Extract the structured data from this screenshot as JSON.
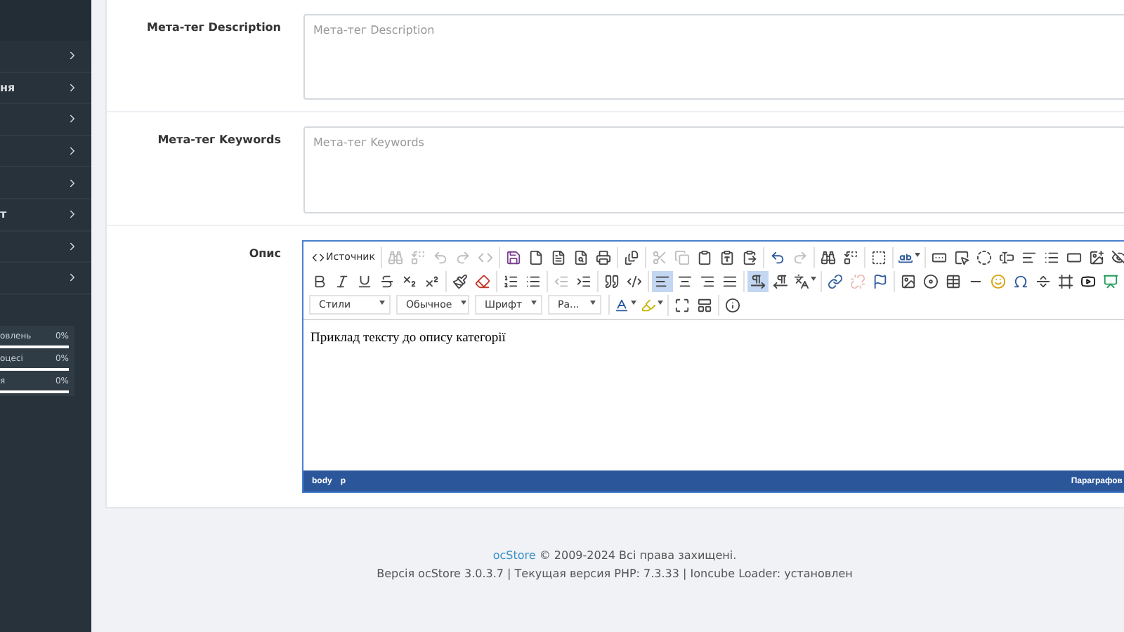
{
  "sidebar": {
    "menu_items": [
      {
        "expanded": false
      },
      {
        "label": "ня",
        "expanded": false
      },
      {
        "expanded": false
      },
      {
        "expanded": false
      },
      {
        "expanded": false
      },
      {
        "label": "т",
        "expanded": false
      },
      {
        "expanded": false
      },
      {
        "expanded": false
      }
    ],
    "stats": [
      {
        "label": "овлень",
        "value": "0%",
        "level": 0
      },
      {
        "label": "оцесі",
        "value": "0%",
        "level": 0
      },
      {
        "label": "я",
        "value": "0%",
        "level": 0
      }
    ]
  },
  "form": {
    "fields": [
      {
        "label": "Мета-тег Description",
        "placeholder": "Мета-тег Description"
      },
      {
        "label": "Мета-тег Keywords",
        "placeholder": "Мета-тег Keywords"
      }
    ],
    "editor": {
      "label": "Опис",
      "toolbar": [
        [
          [
            {
              "kind": "source",
              "label": "Источник"
            }
          ],
          [
            {
              "kind": "button",
              "disabled": true
            },
            {
              "kind": "button",
              "disabled": true
            },
            {
              "kind": "button",
              "disabled": true
            },
            {
              "kind": "button",
              "disabled": true
            },
            {
              "kind": "button",
              "disabled": true
            }
          ],
          [
            {
              "kind": "button",
              "disabled": false
            },
            {
              "kind": "button",
              "disabled": false
            },
            {
              "kind": "button",
              "disabled": false
            },
            {
              "kind": "button",
              "disabled": false
            },
            {
              "kind": "button",
              "disabled": false
            }
          ],
          [
            {
              "kind": "button",
              "disabled": false
            }
          ],
          [
            {
              "kind": "button",
              "disabled": true
            },
            {
              "kind": "button",
              "disabled": true
            },
            {
              "kind": "button",
              "disabled": false
            },
            {
              "kind": "button",
              "disabled": false
            },
            {
              "kind": "button",
              "disabled": false
            }
          ],
          [
            {
              "kind": "button",
              "disabled": false
            },
            {
              "kind": "button",
              "disabled": true
            }
          ],
          [
            {
              "kind": "button",
              "disabled": false
            },
            {
              "kind": "button",
              "disabled": false
            }
          ],
          [
            {
              "kind": "button",
              "disabled": false
            }
          ],
          [
            {
              "kind": "menu",
              "disabled": false
            }
          ],
          [
            {
              "kind": "button",
              "disabled": false
            },
            {
              "kind": "button",
              "disabled": false
            },
            {
              "kind": "button",
              "disabled": false
            },
            {
              "kind": "button",
              "disabled": false
            },
            {
              "kind": "button",
              "disabled": false
            },
            {
              "kind": "button",
              "disabled": false
            },
            {
              "kind": "button",
              "disabled": false
            },
            {
              "kind": "button",
              "disabled": false
            },
            {
              "kind": "button",
              "disabled": false
            }
          ]
        ],
        [
          [
            {
              "kind": "button",
              "disabled": false
            },
            {
              "kind": "button",
              "disabled": false
            },
            {
              "kind": "button",
              "disabled": false
            },
            {
              "kind": "button",
              "disabled": false
            },
            {
              "kind": "button",
              "disabled": false
            },
            {
              "kind": "button",
              "disabled": false
            }
          ],
          [
            {
              "kind": "button",
              "disabled": false
            },
            {
              "kind": "button",
              "disabled": false
            }
          ],
          [
            {
              "kind": "button",
              "disabled": false
            },
            {
              "kind": "button",
              "disabled": false
            }
          ],
          [
            {
              "kind": "button",
              "disabled": true
            },
            {
              "kind": "button",
              "disabled": false
            }
          ],
          [
            {
              "kind": "button",
              "disabled": false
            },
            {
              "kind": "button",
              "disabled": false
            }
          ],
          [
            {
              "kind": "button",
              "disabled": false,
              "selected": true
            },
            {
              "kind": "button",
              "disabled": false,
              "selected": false
            },
            {
              "kind": "button",
              "disabled": false,
              "selected": false
            },
            {
              "kind": "button",
              "disabled": false,
              "selected": false
            }
          ],
          [
            {
              "kind": "button",
              "disabled": false,
              "selected": true
            },
            {
              "kind": "button",
              "disabled": false,
              "selected": false
            },
            {
              "kind": "menu",
              "disabled": false
            }
          ],
          [
            {
              "kind": "button",
              "disabled": false
            },
            {
              "kind": "button",
              "disabled": true
            },
            {
              "kind": "button",
              "disabled": false
            }
          ],
          [
            {
              "kind": "button",
              "disabled": false
            },
            {
              "kind": "button",
              "disabled": false
            },
            {
              "kind": "button",
              "disabled": false
            },
            {
              "kind": "button",
              "disabled": false
            },
            {
              "kind": "button",
              "disabled": false
            },
            {
              "kind": "button",
              "disabled": false
            },
            {
              "kind": "button",
              "disabled": false
            },
            {
              "kind": "button",
              "disabled": false
            },
            {
              "kind": "button",
              "disabled": false
            },
            {
              "kind": "button",
              "disabled": false
            }
          ]
        ],
        [
          [
            {
              "kind": "combo",
              "label": "Стили"
            },
            {
              "kind": "combo",
              "label": "Обычное"
            },
            {
              "kind": "combo",
              "label": "Шрифт"
            },
            {
              "kind": "combo",
              "label": "Ра..."
            }
          ],
          [
            {
              "kind": "menu",
              "disabled": false
            },
            {
              "kind": "menu",
              "disabled": false
            }
          ],
          [
            {
              "kind": "button",
              "disabled": false
            },
            {
              "kind": "button",
              "disabled": false
            }
          ],
          [
            {
              "kind": "button",
              "disabled": false
            }
          ]
        ]
      ],
      "content": "Приклад тексту до опису категорії",
      "path": [
        "body",
        "p"
      ],
      "status": "Параграфов"
    }
  },
  "footer": {
    "brand": "ocStore",
    "copyright": "© 2009-2024 Всі права захищені.",
    "version": "Версія ocStore 3.0.3.7 | Текущая версия PHP: 7.3.33 | Ioncube Loader: установлен"
  }
}
